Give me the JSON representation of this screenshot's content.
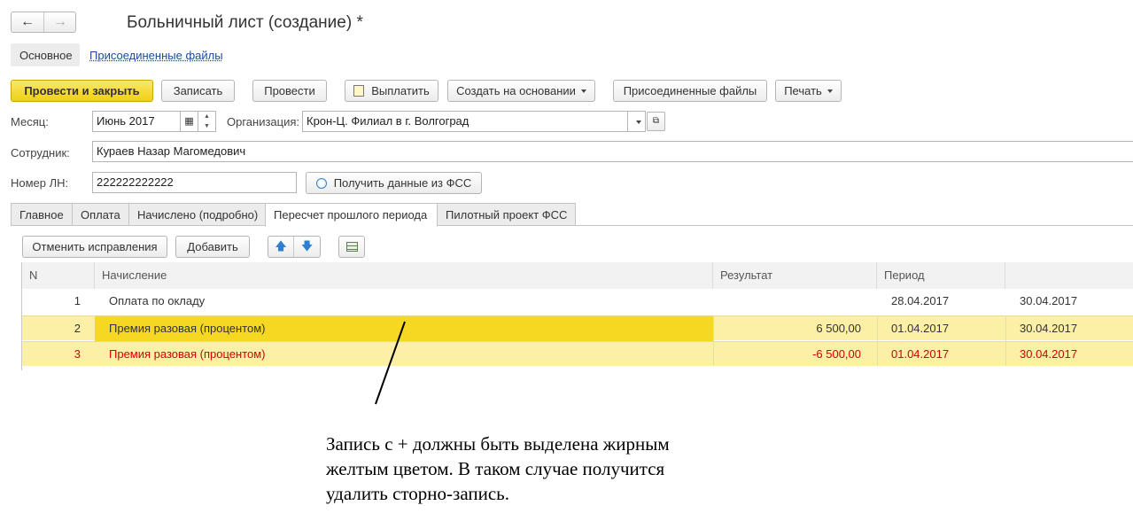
{
  "window": {
    "title": "Больничный лист (создание) *"
  },
  "nav": {
    "main": "Основное",
    "files": "Присоединенные файлы"
  },
  "toolbar": {
    "post_close": "Провести и закрыть",
    "save": "Записать",
    "post": "Провести",
    "pay": "Выплатить",
    "create_based": "Создать на основании",
    "attached": "Присоединенные файлы",
    "print": "Печать"
  },
  "form": {
    "month_label": "Месяц:",
    "month_value": "Июнь 2017",
    "org_label": "Организация:",
    "org_value": "Крон-Ц. Филиал в г. Волгоград",
    "employee_label": "Сотрудник:",
    "employee_value": "Кураев Назар Магомедович",
    "ln_label": "Номер ЛН:",
    "ln_value": "222222222222",
    "fss_button": "Получить данные из ФСС"
  },
  "tabs": [
    "Главное",
    "Оплата",
    "Начислено (подробно)",
    "Пересчет прошлого периода",
    "Пилотный проект ФСС"
  ],
  "table_toolbar": {
    "cancel": "Отменить исправления",
    "add": "Добавить"
  },
  "table": {
    "headers": {
      "n": "N",
      "accrual": "Начисление",
      "result": "Результат",
      "period": "Период",
      "end": ""
    },
    "rows": [
      {
        "n": "1",
        "accrual": "Оплата по окладу",
        "result": "",
        "period": "28.04.2017",
        "end": "30.04.2017"
      },
      {
        "n": "2",
        "accrual": "Премия разовая (процентом)",
        "result": "6 500,00",
        "period": "01.04.2017",
        "end": "30.04.2017"
      },
      {
        "n": "3",
        "accrual": "Премия разовая (процентом)",
        "result": "-6 500,00",
        "period": "01.04.2017",
        "end": "30.04.2017"
      }
    ]
  },
  "annotation": {
    "line1": "Запись с + должны быть выделена жирным",
    "line2": "желтым цветом. В таком случае получится",
    "line3": "удалить сторно-запись."
  }
}
